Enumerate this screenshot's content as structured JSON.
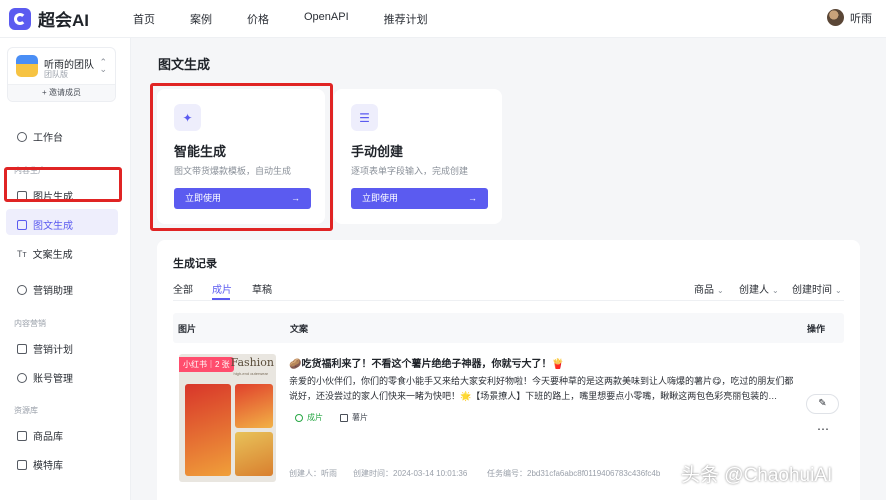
{
  "app": {
    "brand": "超会AI"
  },
  "nav": [
    {
      "label": "首页"
    },
    {
      "label": "案例"
    },
    {
      "label": "价格"
    },
    {
      "label": "OpenAPI"
    },
    {
      "label": "推荐计划"
    }
  ],
  "user": {
    "name": "听雨"
  },
  "team": {
    "name": "听雨的团队",
    "plan": "团队版",
    "invite": "+ 邀请成员"
  },
  "sidebar": {
    "workbench": "工作台",
    "group_content_prod": "内容生产",
    "image_gen": "图片生成",
    "image_text_gen": "图文生成",
    "copy_gen": "文案生成",
    "marketing_assist": "营销助理",
    "group_content_ops": "内容营销",
    "marketing_plan": "营销计划",
    "account_mgmt": "账号管理",
    "group_assets": "资源库",
    "product_lib": "商品库",
    "model_lib": "模特库"
  },
  "page": {
    "title": "图文生成"
  },
  "cards": [
    {
      "title": "智能生成",
      "desc": "图文带货爆款模板，自动生成",
      "button": "立即使用",
      "icon": "magic-wand-icon"
    },
    {
      "title": "手动创建",
      "desc": "逐项表单字段输入，完成创建",
      "button": "立即使用",
      "icon": "form-list-icon"
    }
  ],
  "records": {
    "title": "生成记录",
    "tabs": [
      "全部",
      "成片",
      "草稿"
    ],
    "active_tab": "成片",
    "filters": [
      "商品",
      "创建人",
      "创建时间"
    ],
    "columns": {
      "image": "图片",
      "copy": "文案",
      "action": "操作"
    },
    "rows": [
      {
        "image_tag": "小红书｜2 张",
        "image_caption": "Fashion",
        "image_subcaption": "high-end outerwear",
        "title": "🥔吃货福利来了！不看这个薯片绝绝子神器，你就亏大了！🍟",
        "body": "亲爱的小伙伴们，你们的零食小能手又来给大家安利好物啦！今天要种草的是这两款美味到让人嗨爆的薯片😋，吃过的朋友们都说好，还没尝过的家人们快来一睹为快吧！🌟【场景撩人】下班的路上，嘴里想要点小零嘴，瞅瞅这两包色彩亮丽包装的…",
        "status": "成片",
        "product": "薯片",
        "creator": "创建人：听雨",
        "created_at": "创建时间：2024-03-14 10:01:36",
        "task_id": "任务编号：2bd31cfa6abc8f0119406783c436fc4b"
      }
    ],
    "edit_icon": "✎",
    "more_icon": "⋯"
  },
  "watermark": "头条 @ChaohuiAI",
  "colors": {
    "accent": "#5b5bf0",
    "highlight_red": "#e02424",
    "success": "#28a745"
  }
}
